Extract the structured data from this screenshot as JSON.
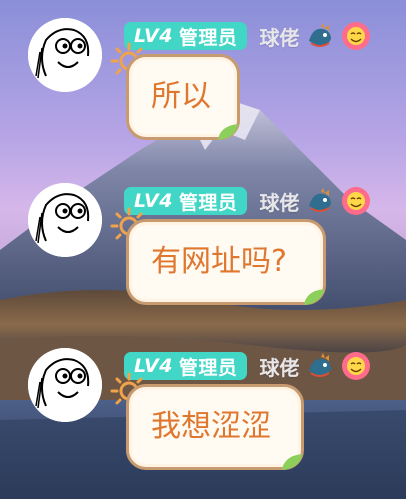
{
  "messages": [
    {
      "level": "LV4",
      "role": "管理员",
      "nick": "球佬",
      "text": "所以"
    },
    {
      "level": "LV4",
      "role": "管理员",
      "nick": "球佬",
      "text": "有网址吗?"
    },
    {
      "level": "LV4",
      "role": "管理员",
      "nick": "球佬",
      "text": "我想涩涩"
    }
  ],
  "colors": {
    "badge": "#41d6c6",
    "bubble_text": "#e0772f",
    "bubble_border": "#c79b6f"
  },
  "icons": [
    "meme-face-avatar",
    "dragon-icon",
    "flower-smiley-icon",
    "sun-icon",
    "leaf-icon"
  ]
}
